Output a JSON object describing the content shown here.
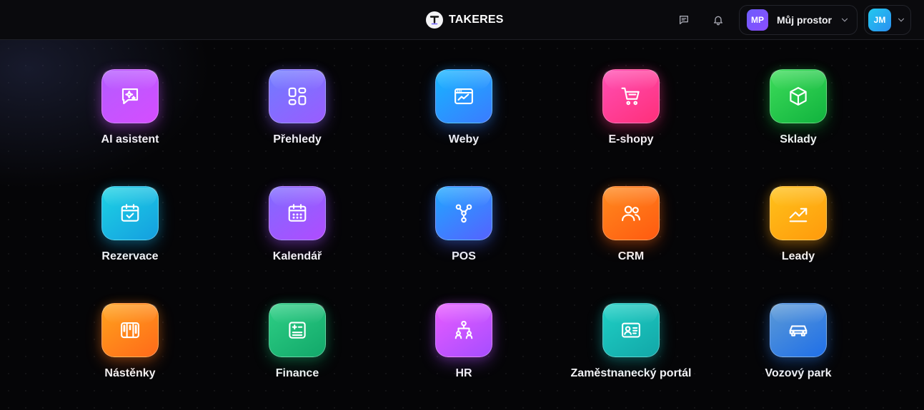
{
  "header": {
    "brand": "TAKERES",
    "workspace": {
      "initials": "MP",
      "name": "Můj prostor"
    },
    "user": {
      "initials": "JM"
    },
    "icons": [
      "message-icon",
      "bell-icon"
    ]
  },
  "apps": [
    {
      "label": "AI asistent",
      "icon": "ai-sparkle-chat-icon",
      "colors": [
        "#b35cff",
        "#d54dff"
      ]
    },
    {
      "label": "Přehledy",
      "icon": "dashboard-grid-icon",
      "colors": [
        "#6f7cff",
        "#9a5cff"
      ]
    },
    {
      "label": "Weby",
      "icon": "browser-chart-icon",
      "colors": [
        "#16b6ff",
        "#3b7bff"
      ]
    },
    {
      "label": "E-shopy",
      "icon": "shopping-cart-icon",
      "colors": [
        "#ff4fb4",
        "#ff2f7a"
      ]
    },
    {
      "label": "Sklady",
      "icon": "box-cube-icon",
      "colors": [
        "#3ddc5a",
        "#11b33e"
      ]
    },
    {
      "label": "Rezervace",
      "icon": "calendar-check-icon",
      "colors": [
        "#1dd3e4",
        "#159fe0"
      ]
    },
    {
      "label": "Kalendář",
      "icon": "calendar-dots-icon",
      "colors": [
        "#7f6bff",
        "#b04cff"
      ]
    },
    {
      "label": "POS",
      "icon": "git-branch-icon",
      "colors": [
        "#1fa8ff",
        "#5562ff"
      ]
    },
    {
      "label": "CRM",
      "icon": "users-icon",
      "colors": [
        "#ff8a1e",
        "#ff5a10"
      ]
    },
    {
      "label": "Leady",
      "icon": "trending-up-icon",
      "colors": [
        "#ffc21a",
        "#ff9a0c"
      ]
    },
    {
      "label": "Nástěnky",
      "icon": "kanban-board-icon",
      "colors": [
        "#ffa21c",
        "#ff6a1a"
      ]
    },
    {
      "label": "Finance",
      "icon": "calculator-icon",
      "colors": [
        "#2ecf85",
        "#12a86a"
      ]
    },
    {
      "label": "HR",
      "icon": "org-chart-icon",
      "colors": [
        "#e85cff",
        "#a64dff"
      ]
    },
    {
      "label": "Zaměstnanecký portál",
      "icon": "id-card-icon",
      "colors": [
        "#1fd0c5",
        "#12a7a8"
      ]
    },
    {
      "label": "Vozový park",
      "icon": "car-icon",
      "colors": [
        "#5c9ad6",
        "#1f6fe8"
      ]
    }
  ]
}
